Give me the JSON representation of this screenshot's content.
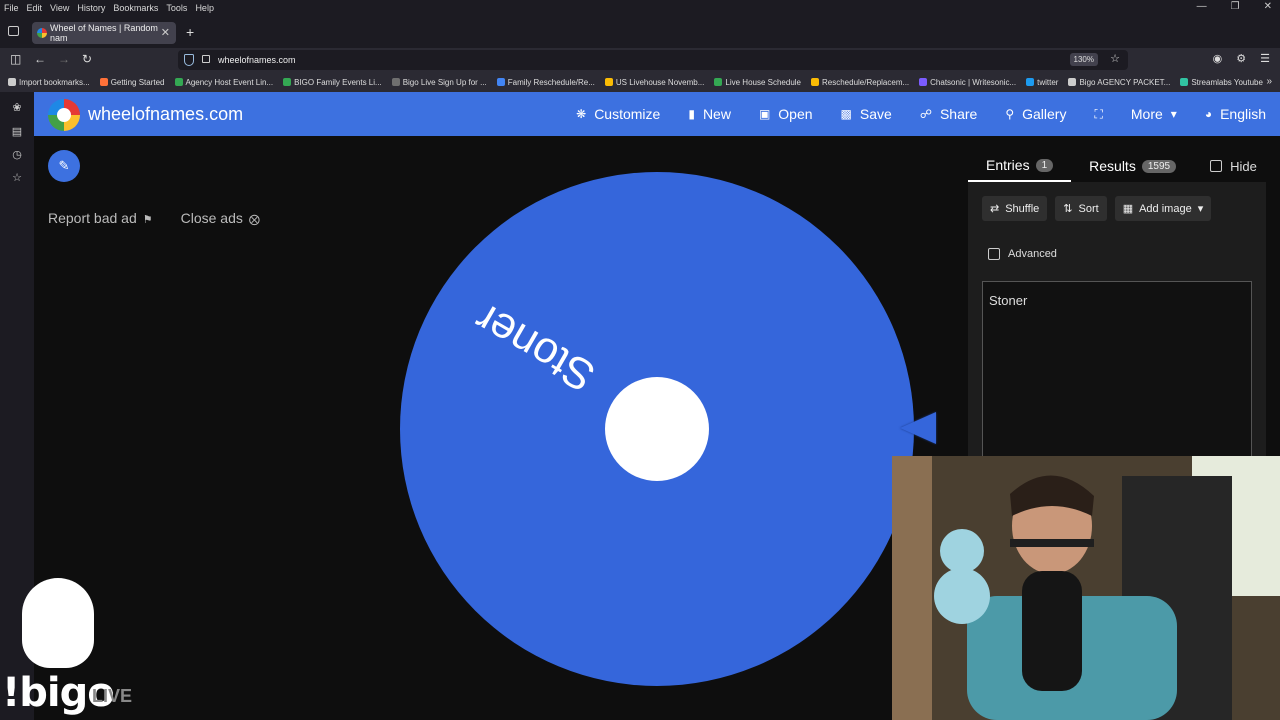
{
  "browser": {
    "menu": [
      "File",
      "Edit",
      "View",
      "History",
      "Bookmarks",
      "Tools",
      "Help"
    ],
    "tab_title": "Wheel of Names | Random nam",
    "url": "wheelofnames.com",
    "zoom": "130%",
    "bookmarks": [
      {
        "label": "Import bookmarks...",
        "color": "#cccccc"
      },
      {
        "label": "Getting Started",
        "color": "#ff7139"
      },
      {
        "label": "Agency Host Event Lin...",
        "color": "#34a853"
      },
      {
        "label": "BIGO Family Events Li...",
        "color": "#34a853"
      },
      {
        "label": "Bigo Live Sign Up for ...",
        "color": "#6f6f6f"
      },
      {
        "label": "Family Reschedule/Re...",
        "color": "#4285f4"
      },
      {
        "label": "US Livehouse Novemb...",
        "color": "#fbbc04"
      },
      {
        "label": "Live House Schedule",
        "color": "#34a853"
      },
      {
        "label": "Reschedule/Replacem...",
        "color": "#fbbc04"
      },
      {
        "label": "Chatsonic | Writesonic...",
        "color": "#7b5cff"
      },
      {
        "label": "twitter",
        "color": "#1d9bf0"
      },
      {
        "label": "Bigo AGENCY PACKET...",
        "color": "#cccccc"
      },
      {
        "label": "Streamlabs Youtube",
        "color": "#31c3a2"
      }
    ]
  },
  "app": {
    "brand": "wheelofnames.com",
    "accent": "#3d71e0",
    "menu": [
      {
        "label": "Customize",
        "icon": "palette-icon"
      },
      {
        "label": "New",
        "icon": "file-icon"
      },
      {
        "label": "Open",
        "icon": "folder-open-icon"
      },
      {
        "label": "Save",
        "icon": "save-icon"
      },
      {
        "label": "Share",
        "icon": "share-icon"
      },
      {
        "label": "Gallery",
        "icon": "search-icon"
      },
      {
        "label": "",
        "icon": "fullscreen-icon"
      },
      {
        "label": "More",
        "icon": "chevron-down-icon"
      },
      {
        "label": "English",
        "icon": "globe-icon"
      }
    ]
  },
  "ads": {
    "report": "Report bad ad",
    "close": "Close ads"
  },
  "wheel": {
    "color": "#3566db",
    "slice_label": "Stoner"
  },
  "panel": {
    "entries_tab": "Entries",
    "entries_count": "1",
    "results_tab": "Results",
    "results_count": "1595",
    "hide_label": "Hide",
    "shuffle": "Shuffle",
    "sort": "Sort",
    "add_image": "Add image",
    "advanced": "Advanced",
    "entries_text": "Stoner"
  },
  "overlay": {
    "bigo_logo": "!bigo",
    "bigo_live": "LIVE"
  }
}
